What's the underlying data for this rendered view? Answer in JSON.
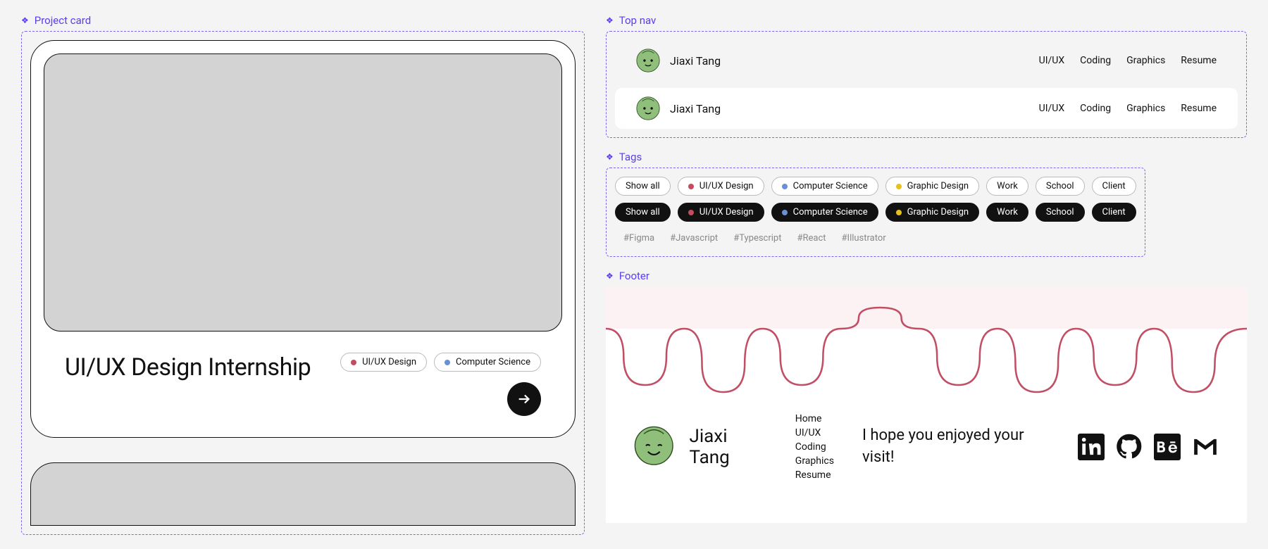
{
  "sections": {
    "project_card": "Project card",
    "top_nav": "Top nav",
    "tags": "Tags",
    "footer": "Footer"
  },
  "project": {
    "title": "UI/UX Design Internship",
    "tags": [
      {
        "label": "UI/UX Design",
        "color": "#c44c5e"
      },
      {
        "label": "Computer Science",
        "color": "#6a8fd6"
      }
    ]
  },
  "nav": {
    "name": "Jiaxi Tang",
    "links": [
      "UI/UX",
      "Coding",
      "Graphics",
      "Resume"
    ]
  },
  "tag_filters": {
    "row_light": [
      {
        "label": "Show all",
        "color": null
      },
      {
        "label": "UI/UX Design",
        "color": "#c44c5e"
      },
      {
        "label": "Computer Science",
        "color": "#6a8fd6"
      },
      {
        "label": "Graphic Design",
        "color": "#e6c31b"
      },
      {
        "label": "Work",
        "color": null
      },
      {
        "label": "School",
        "color": null
      },
      {
        "label": "Client",
        "color": null
      }
    ],
    "row_dark": [
      {
        "label": "Show all",
        "color": null
      },
      {
        "label": "UI/UX Design",
        "color": "#c44c5e"
      },
      {
        "label": "Computer Science",
        "color": "#6a8fd6"
      },
      {
        "label": "Graphic Design",
        "color": "#e6c31b"
      },
      {
        "label": "Work",
        "color": null
      },
      {
        "label": "School",
        "color": null
      },
      {
        "label": "Client",
        "color": null
      }
    ],
    "hash": [
      "#Figma",
      "#Javascript",
      "#Typescript",
      "#React",
      "#Illustrator"
    ]
  },
  "footer": {
    "name": "Jiaxi Tang",
    "links": [
      "Home",
      "UI/UX",
      "Coding",
      "Graphics",
      "Resume"
    ],
    "message": "I hope you enjoyed your visit!",
    "social": [
      "linkedin-icon",
      "github-icon",
      "behance-icon",
      "gmail-icon"
    ],
    "drip_color": "#c14e64",
    "drip_bg": "#fdf2f3"
  }
}
